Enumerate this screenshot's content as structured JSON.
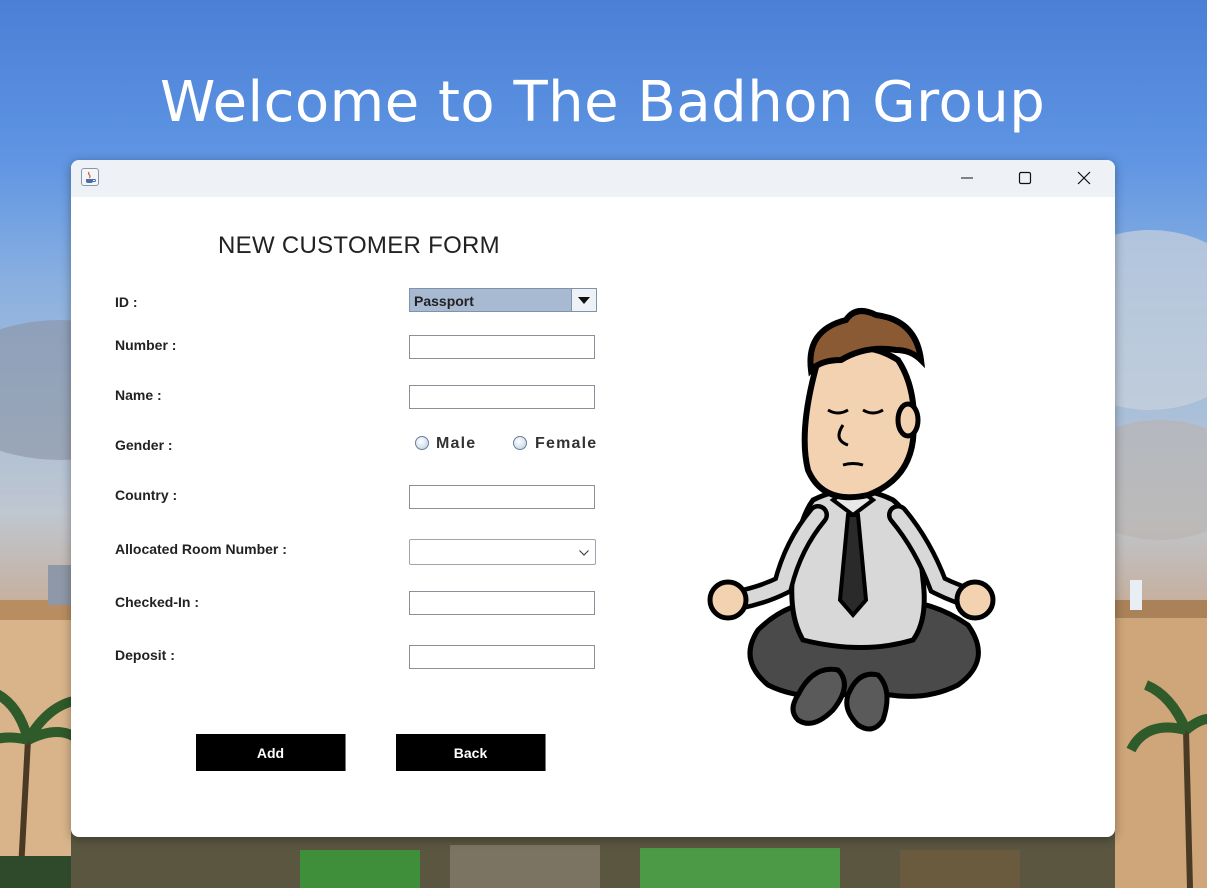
{
  "banner": {
    "welcome_text": "Welcome to The Badhon Group"
  },
  "window": {
    "controls": {
      "minimize": "minimize-icon",
      "maximize": "maximize-icon",
      "close": "close-icon"
    }
  },
  "form": {
    "title": "NEW CUSTOMER FORM",
    "id_label": "ID :",
    "id_selected": "Passport",
    "number_label": "Number :",
    "number_value": "",
    "name_label": "Name :",
    "name_value": "",
    "gender_label": "Gender :",
    "gender_options": [
      "Male",
      "Female"
    ],
    "country_label": "Country :",
    "country_value": "",
    "room_label": "Allocated Room Number :",
    "room_selected": "",
    "checkin_label": "Checked-In :",
    "checkin_value": "",
    "deposit_label": "Deposit :",
    "deposit_value": ""
  },
  "buttons": {
    "add": "Add",
    "back": "Back"
  },
  "colors": {
    "combo_selected_bg": "#a8bad1",
    "button_bg": "#000000",
    "titlebar_bg": "#eef1f6"
  }
}
